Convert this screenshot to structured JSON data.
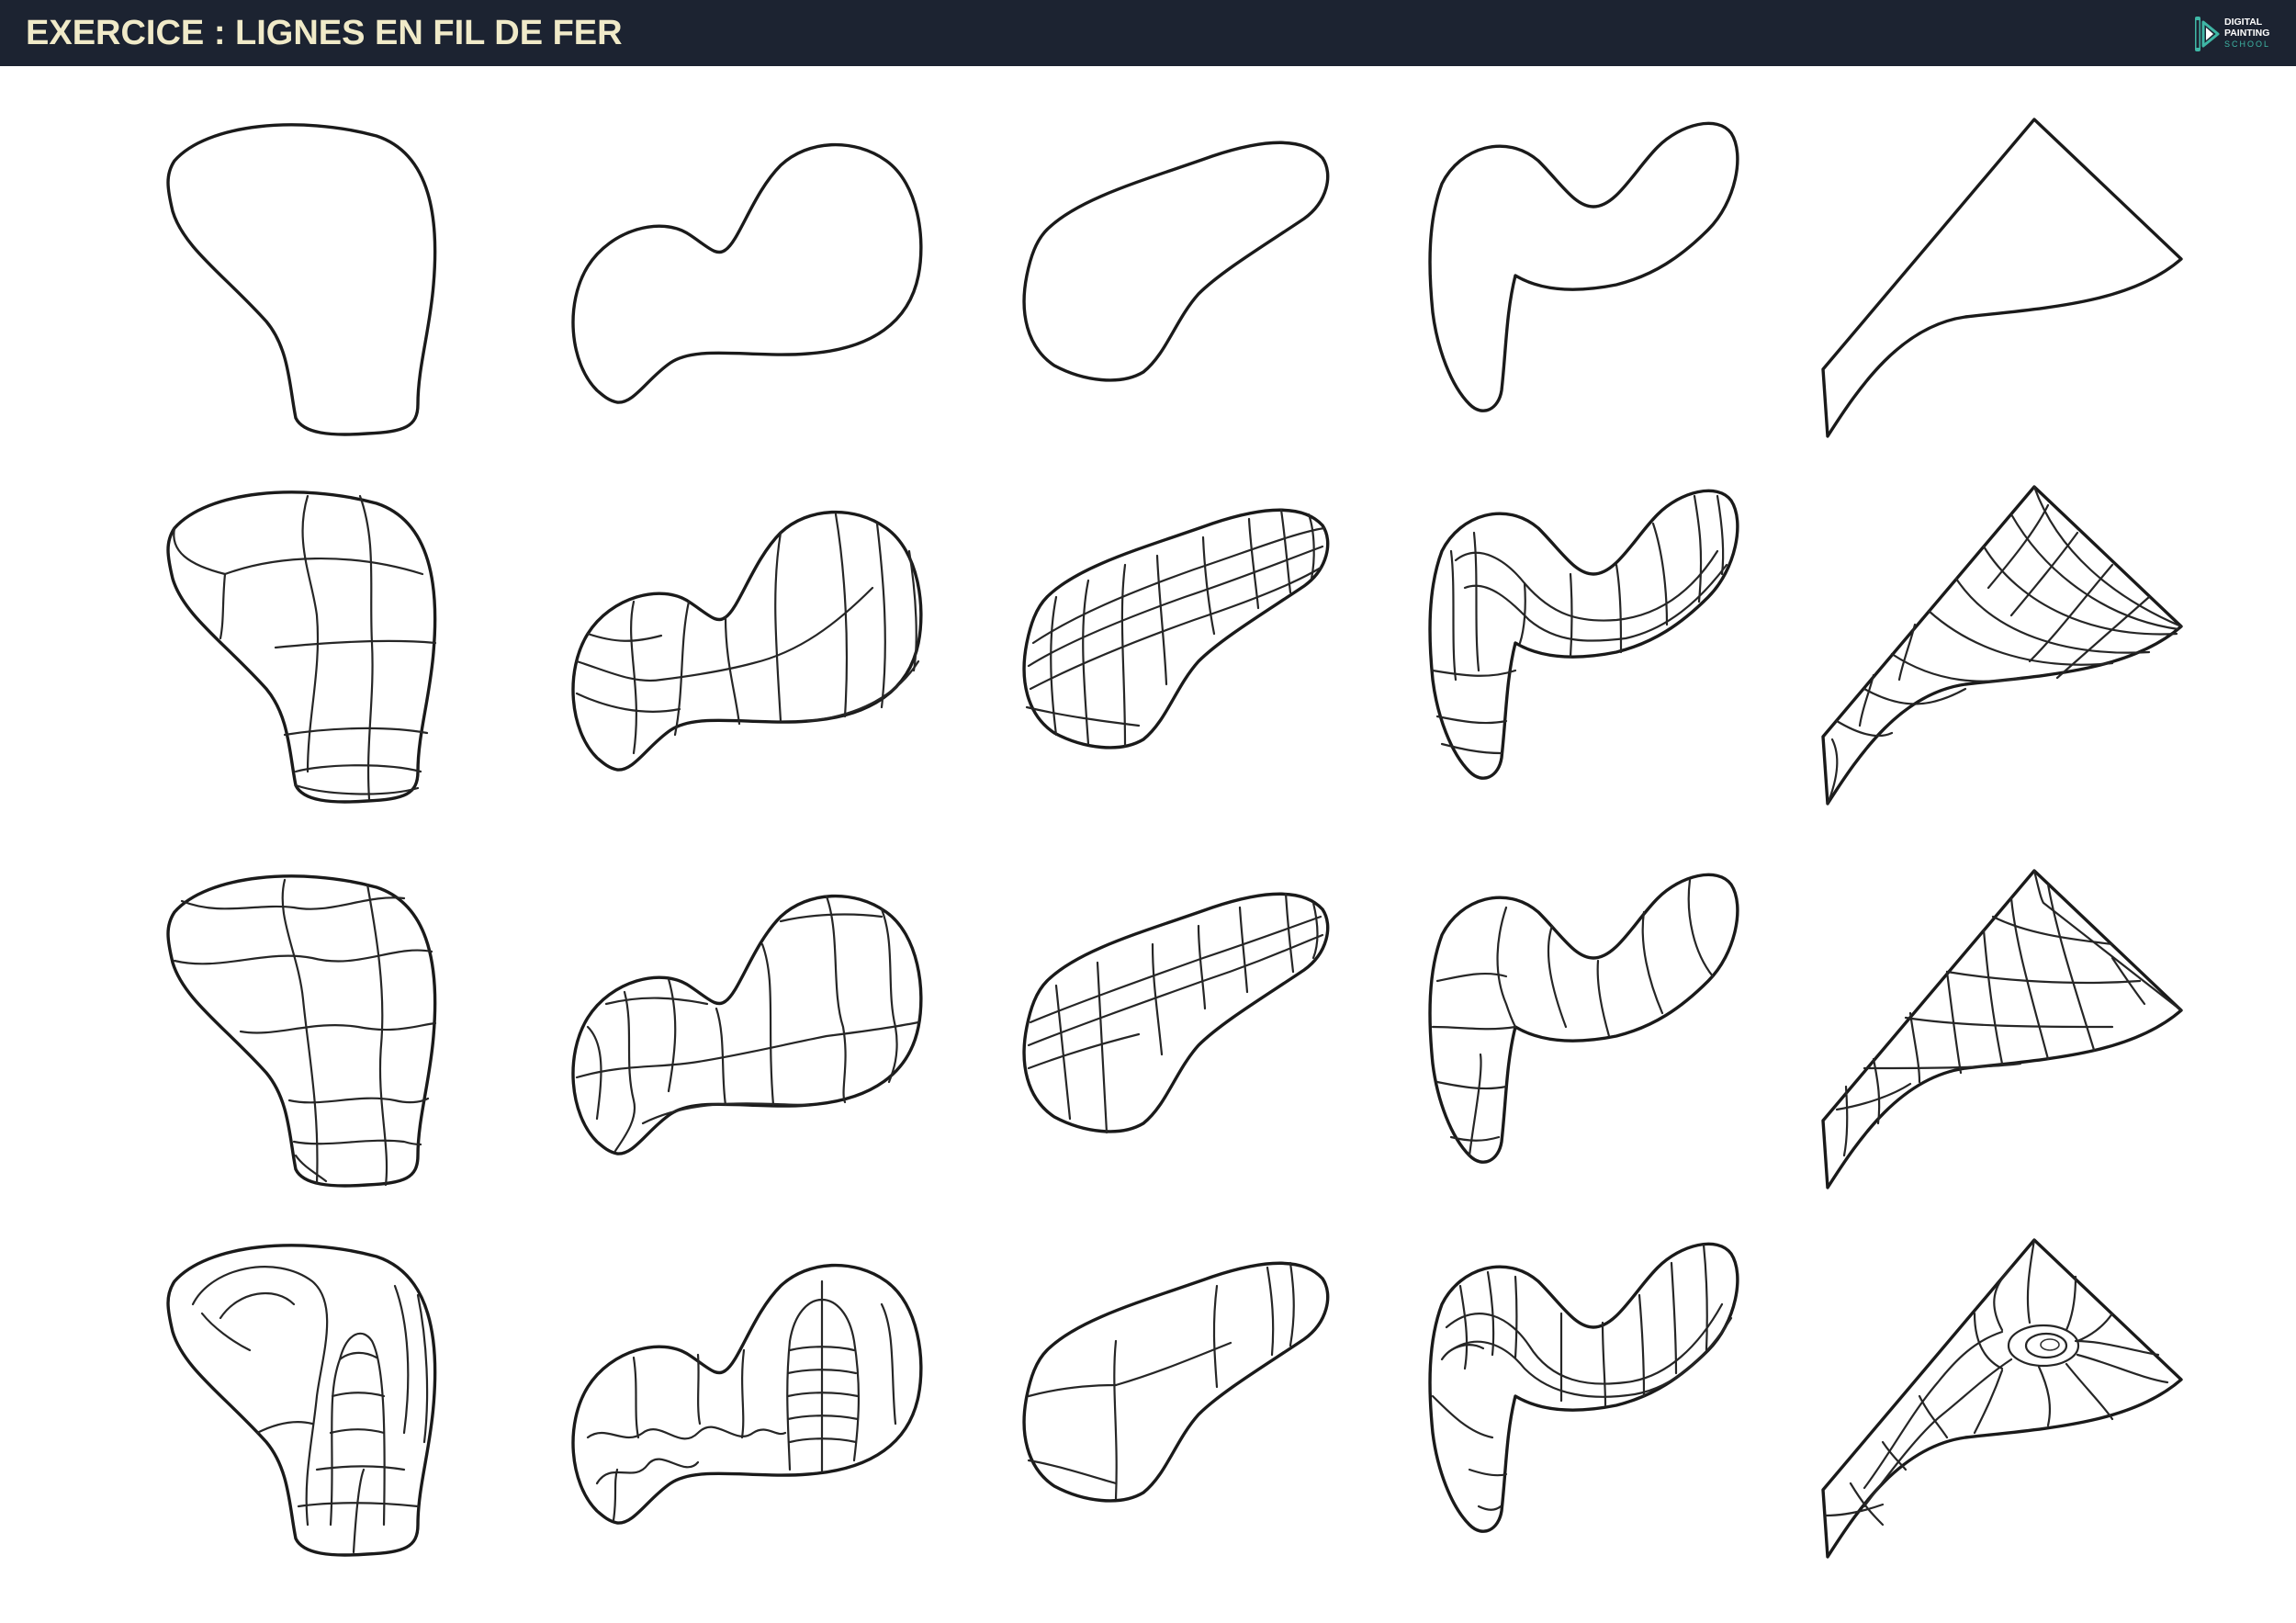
{
  "header": {
    "title": "EXERCICE : LIGNES EN FIL DE FER",
    "background": "#1c2331",
    "title_color": "#f0eac8"
  },
  "logo": {
    "line1": "DIGITAL",
    "line2": "PAINTING",
    "line3": "SCHOOL",
    "accent_color": "#3fb7a6"
  },
  "grid": {
    "columns": [
      "shape-1",
      "shape-2",
      "shape-3",
      "shape-4",
      "shape-5"
    ],
    "rows": [
      "outline",
      "wireframe-a",
      "wireframe-b",
      "wireframe-c"
    ],
    "line_color": "#1a1a1a"
  }
}
